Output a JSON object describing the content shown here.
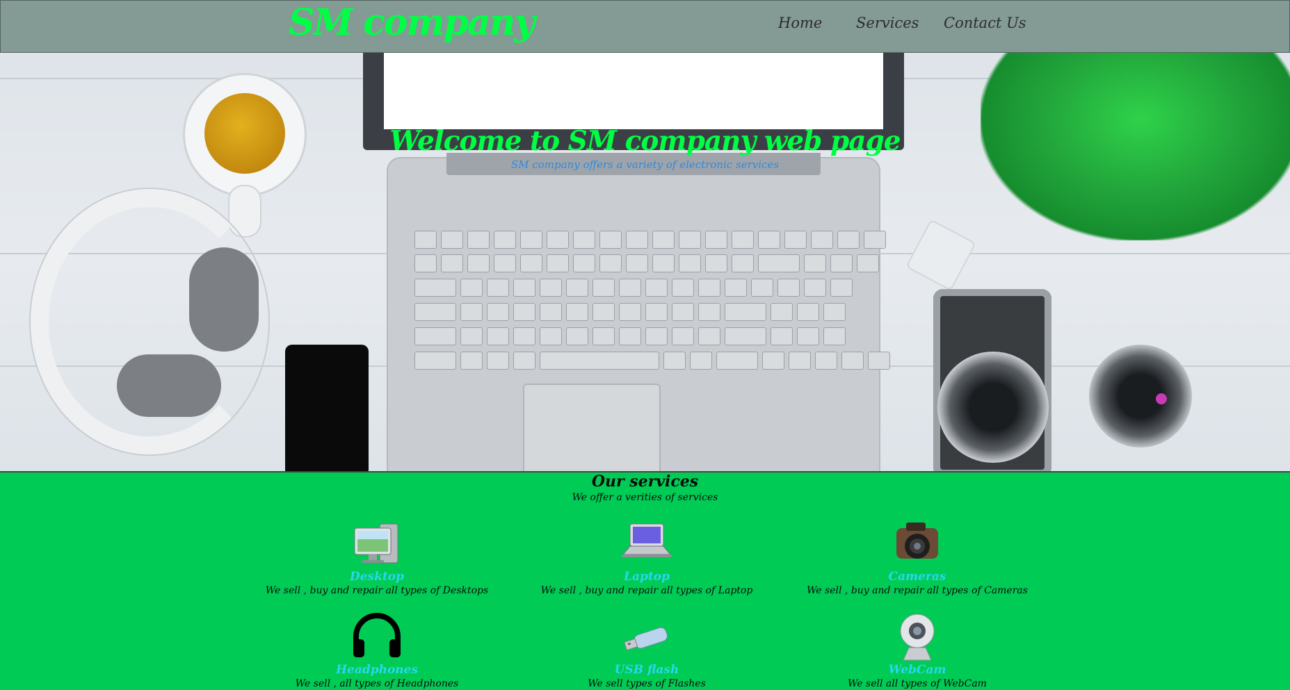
{
  "brand": {
    "name": "SM company",
    "accent": "#00ff44"
  },
  "nav": {
    "items": [
      {
        "label": "Home"
      },
      {
        "label": "Services"
      },
      {
        "label": "Contact Us"
      }
    ]
  },
  "hero": {
    "title": "Welcome to SM company web page",
    "subtitle": "SM company offers a variety of electronic services"
  },
  "services": {
    "title": "Our services",
    "subtitle": "We offer a verities of services",
    "items": [
      {
        "name": "Desktop",
        "desc": "We sell , buy and repair all types of Desktops",
        "icon": "desktop-icon"
      },
      {
        "name": "Laptop",
        "desc": "We sell , buy and repair all types of Laptop",
        "icon": "laptop-icon"
      },
      {
        "name": "Cameras",
        "desc": "We sell , buy and repair all types of Cameras",
        "icon": "camera-icon"
      },
      {
        "name": "Headphones",
        "desc": "We sell , all types of Headphones",
        "icon": "headphones-icon"
      },
      {
        "name": "USB flash",
        "desc": "We sell types of Flashes",
        "icon": "usb-flash-icon"
      },
      {
        "name": "WebCam",
        "desc": "We sell all types of WebCam",
        "icon": "webcam-icon"
      }
    ]
  },
  "colors": {
    "header_bg": "#839a95",
    "section_bg": "#00cc55",
    "service_name": "#2ad6f0",
    "hero_subtitle": "#2f8ae0"
  }
}
